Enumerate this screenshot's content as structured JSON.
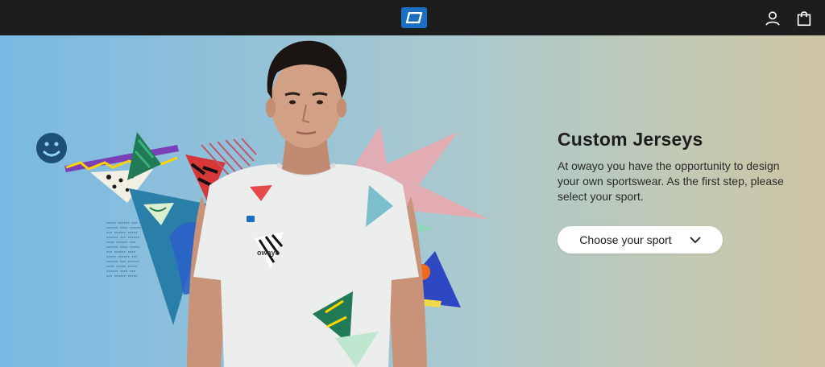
{
  "header": {
    "logo_icon": "owayo-logo-icon",
    "icons": [
      "account-icon",
      "cart-icon"
    ]
  },
  "hero": {
    "title": "Custom Jerseys",
    "description": "At owayo you have the opportunity to design your own sportswear. As the first step, please select your sport.",
    "cta_label": "Choose your sport",
    "shirt_logo_text": "owayo"
  },
  "colors": {
    "header_bg": "#1d1d1d",
    "brand_blue": "#1a6fc2",
    "text_dark": "#1d1d1d",
    "cta_bg": "#ffffff"
  }
}
